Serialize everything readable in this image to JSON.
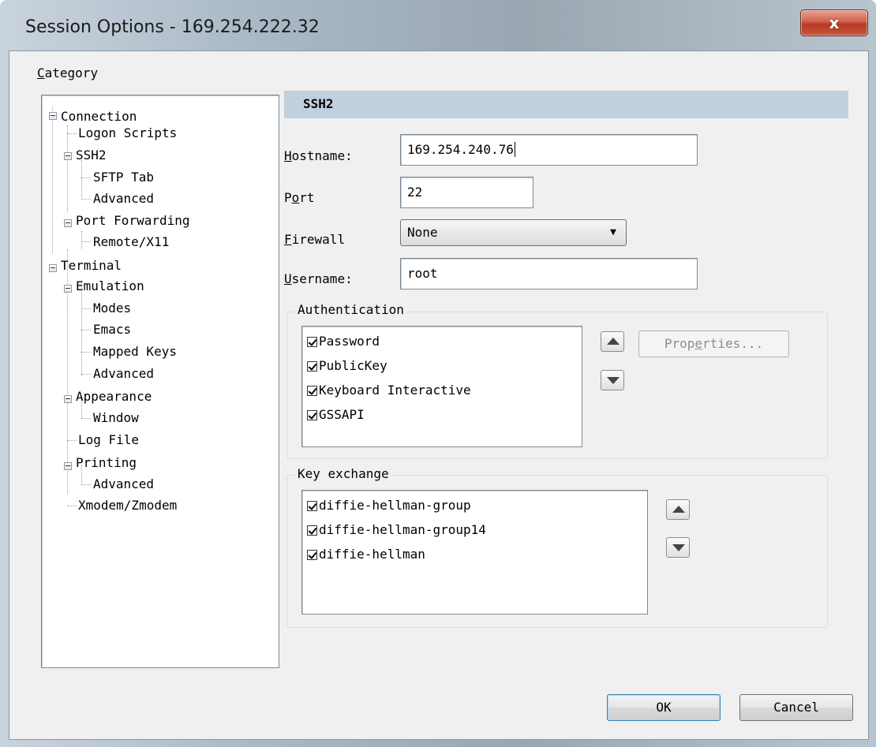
{
  "window": {
    "title": "Session Options - 169.254.222.32",
    "close_glyph": "x"
  },
  "category": {
    "label_first": "C",
    "label_rest": "ategory"
  },
  "tree": [
    {
      "label": "Connection"
    },
    {
      "label": "Logon Scripts"
    },
    {
      "label": "SSH2"
    },
    {
      "label": "SFTP Tab"
    },
    {
      "label": "Advanced"
    },
    {
      "label": "Port Forwarding"
    },
    {
      "label": "Remote/X11"
    },
    {
      "label": "Terminal"
    },
    {
      "label": "Emulation"
    },
    {
      "label": "Modes"
    },
    {
      "label": "Emacs"
    },
    {
      "label": "Mapped Keys"
    },
    {
      "label": "Advanced"
    },
    {
      "label": "Appearance"
    },
    {
      "label": "Window"
    },
    {
      "label": "Log File"
    },
    {
      "label": "Printing"
    },
    {
      "label": "Advanced"
    },
    {
      "label": "Xmodem/Zmodem"
    }
  ],
  "section": {
    "title": "SSH2"
  },
  "form": {
    "hostname": {
      "label_first": "H",
      "label_rest": "ostname:",
      "value": "169.254.240.76"
    },
    "port": {
      "label_a": "P",
      "label_u": "o",
      "label_b": "rt",
      "value": "22"
    },
    "firewall": {
      "label_first": "F",
      "label_rest": "irewall",
      "value": "None",
      "arrow": "▼"
    },
    "username": {
      "label_first": "U",
      "label_rest": "sername:",
      "value": "root"
    }
  },
  "authentication": {
    "title": "Authentication",
    "items": [
      "Password",
      "PublicKey",
      "Keyboard Interactive",
      "GSSAPI"
    ],
    "properties_a": "Prop",
    "properties_u": "e",
    "properties_b": "rties..."
  },
  "key_exchange": {
    "title": "Key exchange",
    "items": [
      "diffie-hellman-group",
      "diffie-hellman-group14",
      "diffie-hellman"
    ]
  },
  "buttons": {
    "ok": "OK",
    "cancel": "Cancel"
  },
  "icons": [
    "close-icon",
    "expander-icon",
    "arrow-up-icon",
    "arrow-down-icon",
    "dropdown-arrow-icon",
    "checkbox-checked-icon"
  ]
}
